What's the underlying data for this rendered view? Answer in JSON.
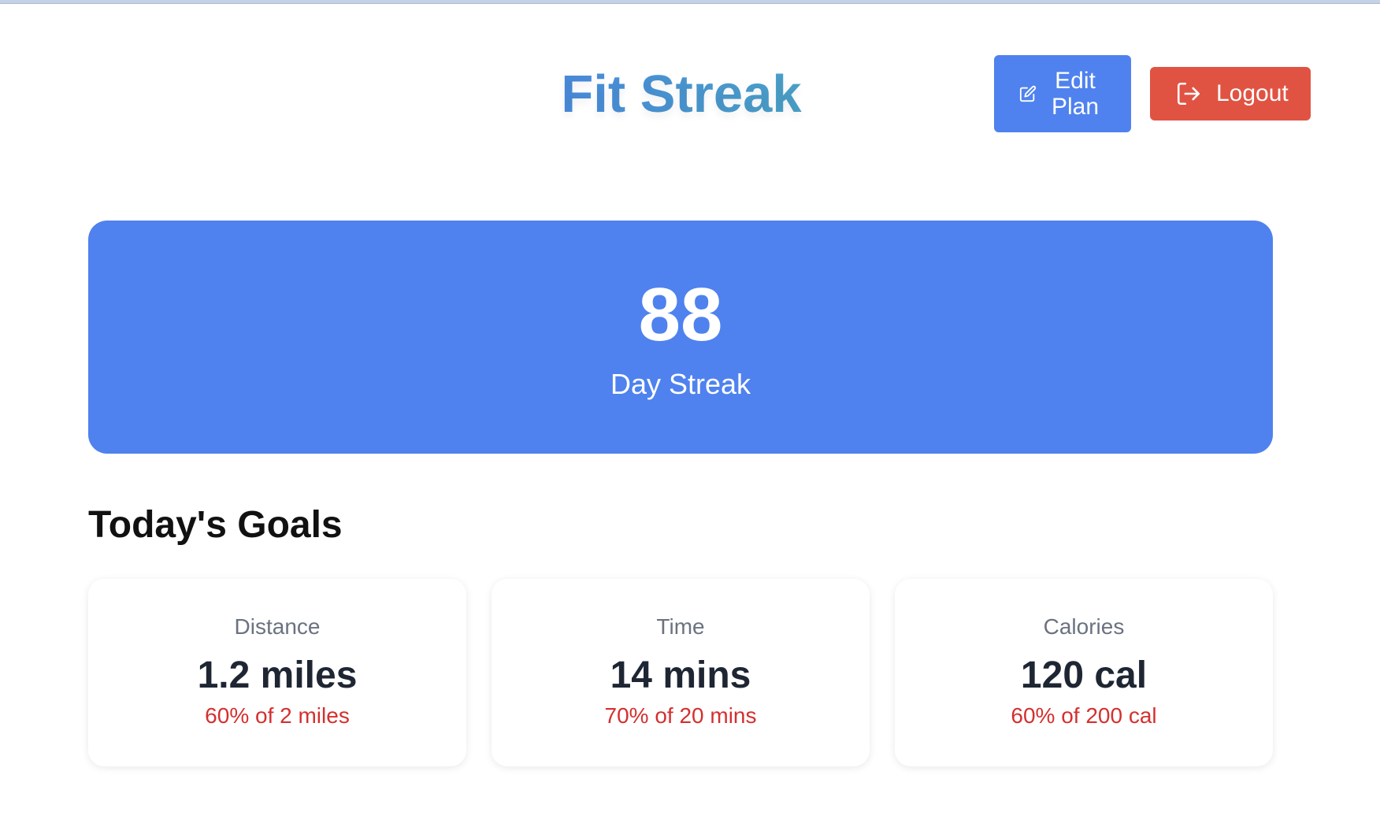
{
  "header": {
    "title": "Fit Streak",
    "edit_plan_label": "Edit Plan",
    "logout_label": "Logout"
  },
  "streak": {
    "count": "88",
    "label": "Day Streak"
  },
  "goals_section": {
    "title": "Today's Goals",
    "items": [
      {
        "label": "Distance",
        "value": "1.2 miles",
        "progress": "60% of 2 miles"
      },
      {
        "label": "Time",
        "value": "14 mins",
        "progress": "70% of 20 mins"
      },
      {
        "label": "Calories",
        "value": "120 cal",
        "progress": "60% of 200 cal"
      }
    ]
  },
  "colors": {
    "primary": "#4f82ee",
    "danger": "#e05343",
    "progress_text": "#d4302f"
  },
  "icons": {
    "edit": "edit-icon",
    "logout": "logout-icon"
  }
}
